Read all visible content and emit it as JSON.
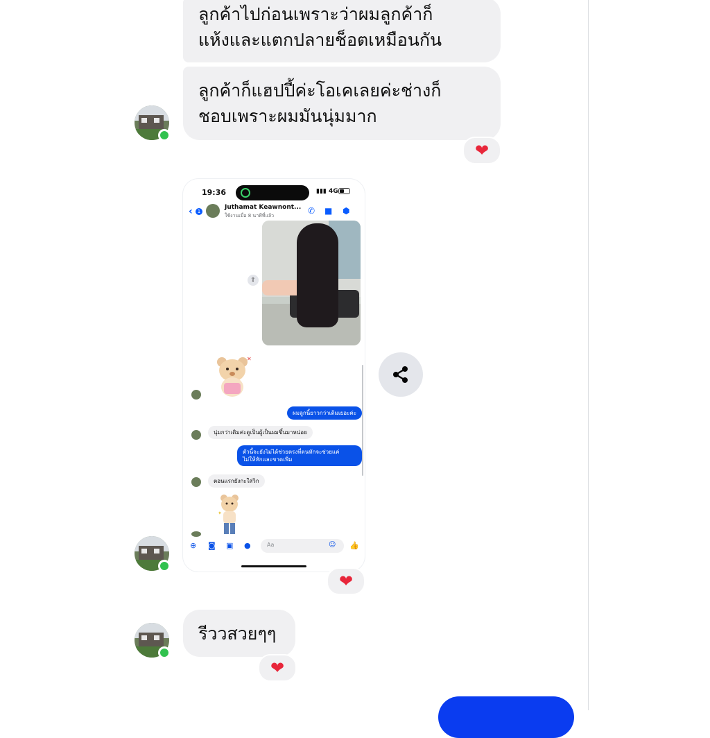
{
  "messages": [
    {
      "lines": [
        "ลูกค้าไปก่อนเพราะว่าผมลูกค้าก็",
        "แห้งและแตกปลายช็อตเหมือนกัน"
      ]
    },
    {
      "lines": [
        "ลูกค้าก็แฮปปี้ค่ะโอเคเลยค่ะช่างก็",
        "ชอบเพราะผมมันนุ่มมาก"
      ],
      "reaction": "❤"
    },
    {
      "type": "image",
      "reaction": "❤"
    },
    {
      "lines": [
        "รีววสวยๆๆ"
      ],
      "reaction": "❤"
    }
  ],
  "share_icon": "share-icon",
  "colors": {
    "incoming_bubble": "#f0f0f2",
    "outgoing_bubble": "#0a3cf0",
    "heart": "#e8263a",
    "online": "#31c24e"
  },
  "screenshot": {
    "status_time": "19:36",
    "network": "4G",
    "back_count": "1",
    "contact_name": "Juthamat Keawnont...",
    "contact_status": "ใช้งานเมื่อ 8 นาทีที่แล้ว",
    "chat": [
      {
        "dir": "out",
        "text": "ผมลูกนี้ยาวกว่าเดิมเยอะค่ะ"
      },
      {
        "dir": "in",
        "text": "นุ่มกว่าเดิมค่ะดูเป็นผู้เป็นผมขึ้นมาหน่อย"
      },
      {
        "dir": "out",
        "lines": [
          "ตัวนี้จะยังไม่ได้ช่วยตรงที่ตนหักจะช่วยแค่",
          "ไม่ให้หักและขาดเพิ่ม"
        ]
      },
      {
        "dir": "in",
        "text": "ตอนแรกยังกะใส่วิก"
      }
    ],
    "input_placeholder": "Aa"
  }
}
